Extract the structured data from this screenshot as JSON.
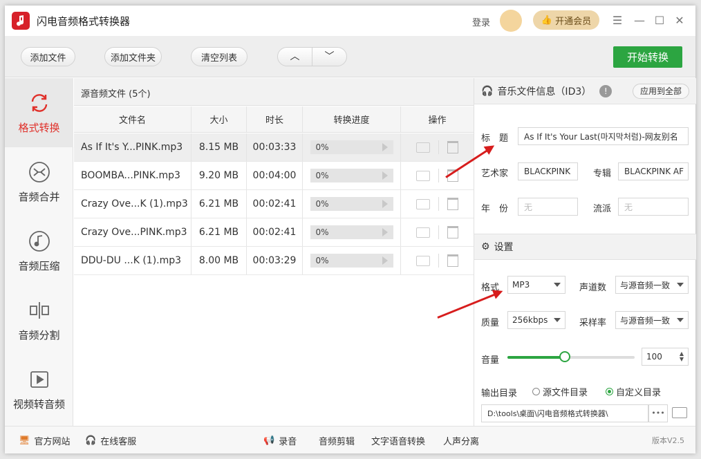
{
  "app": {
    "title": "闪电音频格式转换器",
    "login": "登录",
    "vip": "开通会员"
  },
  "toolbar": {
    "add_file": "添加文件",
    "add_folder": "添加文件夹",
    "clear_list": "清空列表",
    "start": "开始转换"
  },
  "sidebar": [
    {
      "label": "格式转换",
      "active": true
    },
    {
      "label": "音频合并"
    },
    {
      "label": "音频压缩"
    },
    {
      "label": "音频分割"
    },
    {
      "label": "视频转音频"
    }
  ],
  "filelist": {
    "header": "源音频文件 (5个)",
    "columns": [
      "文件名",
      "大小",
      "时长",
      "转换进度",
      "操作"
    ],
    "rows": [
      {
        "name": "As If It's Y...PINK.mp3",
        "size": "8.15 MB",
        "duration": "00:03:33",
        "progress": "0%"
      },
      {
        "name": "BOOMBA...PINK.mp3",
        "size": "9.20 MB",
        "duration": "00:04:00",
        "progress": "0%"
      },
      {
        "name": "Crazy Ove...K (1).mp3",
        "size": "6.21 MB",
        "duration": "00:02:41",
        "progress": "0%"
      },
      {
        "name": "Crazy Ove...PINK.mp3",
        "size": "6.21 MB",
        "duration": "00:02:41",
        "progress": "0%"
      },
      {
        "name": "DDU-DU ...K (1).mp3",
        "size": "8.00 MB",
        "duration": "00:03:29",
        "progress": "0%"
      }
    ]
  },
  "id3": {
    "header": "音乐文件信息（ID3）",
    "apply_all": "应用到全部",
    "title_label": "标　题",
    "title_value": "As If It's Your Last(마지막처럼)-网友别名",
    "artist_label": "艺术家",
    "artist_value": "BLACKPINK",
    "album_label": "专辑",
    "album_value": "BLACKPINK AF",
    "year_label": "年　份",
    "year_placeholder": "无",
    "genre_label": "流派",
    "genre_placeholder": "无"
  },
  "settings": {
    "header": "设置",
    "format_label": "格式",
    "format_value": "MP3",
    "channels_label": "声道数",
    "channels_value": "与源音频一致",
    "quality_label": "质量",
    "quality_value": "256kbps",
    "samplerate_label": "采样率",
    "samplerate_value": "与源音频一致",
    "volume_label": "音量",
    "volume_value": "100",
    "volume_level": 0.45,
    "output_label": "输出目录",
    "radio_source": "源文件目录",
    "radio_custom": "自定义目录",
    "output_path": "D:\\tools\\桌面\\闪电音频格式转换器\\",
    "dots": "•••"
  },
  "bottom": {
    "website": "官方网站",
    "service": "在线客服",
    "record": "录音",
    "cut": "音频剪辑",
    "tts": "文字语音转换",
    "vocal": "人声分离",
    "version": "版本V2.5"
  },
  "colors": {
    "accent_red": "#e0312b",
    "start_green": "#2ca541",
    "vip_gold": "#eed6a9",
    "arrow_red": "#d71d1d"
  }
}
